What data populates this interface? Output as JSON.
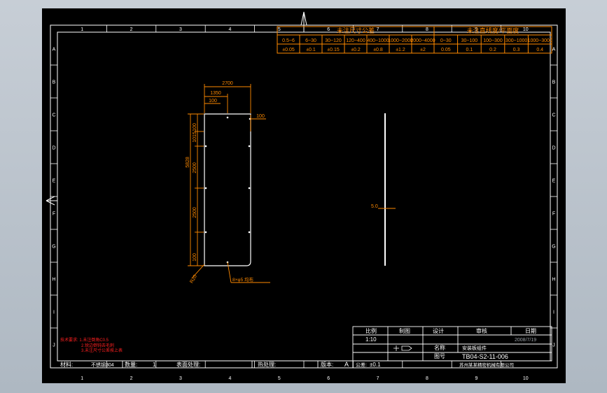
{
  "border": {
    "col_numbers": [
      "1",
      "2",
      "3",
      "4",
      "5",
      "6",
      "7",
      "8",
      "9",
      "10"
    ],
    "row_letters": [
      "A",
      "B",
      "C",
      "D",
      "E",
      "F",
      "G",
      "H",
      "I",
      "J"
    ]
  },
  "tolerance_table": {
    "left_header": "未注尺寸公差",
    "right_header": "未注直线度/平面度",
    "left_ranges": [
      "0.5~6",
      "6~30",
      "30~120",
      "120~400",
      "400~1000",
      "1000~2000",
      "2000~4000"
    ],
    "left_tols": [
      "±0.05",
      "±0.1",
      "±0.15",
      "±0.2",
      "±0.8",
      "±1.2",
      "±2"
    ],
    "right_ranges": [
      "0~30",
      "30~100",
      "100~300",
      "300~1000",
      "1000~3000"
    ],
    "right_tols": [
      "0.05",
      "0.1",
      "0.2",
      "0.3",
      "0.4"
    ]
  },
  "drawing": {
    "dim_2700": "2700",
    "dim_1350": "1350",
    "dim_100_top": "100",
    "dim_100_right": "100",
    "dim_100_vert_top": "100",
    "dim_1015": "1015",
    "dim_5828": "5828",
    "dim_2500_a": "2500",
    "dim_2500_b": "2500",
    "dim_100_vert_bot": "100",
    "dim_r20": "R20",
    "hole_note": "8×φ5 均布",
    "side_thickness": "5.0"
  },
  "title_block": {
    "scale_label": "比例",
    "scale_value": "1:10",
    "drawn_label": "制图",
    "design_label": "设计",
    "check_label": "审核",
    "date_label": "日期",
    "date_value": "2008/7/19",
    "name_label": "名称",
    "part_name": "安装板组件",
    "drawing_no_label": "图号",
    "drawing_no": "TB04-S2-11-006",
    "material_label": "材料:",
    "material_value": "不锈钢304",
    "qty_label": "数量:",
    "qty_value": "1",
    "surface_label": "表面处理:",
    "heat_label": "热处理:",
    "version_label": "版本:",
    "version_value": "A",
    "tol_label": "公差:",
    "tol_value": "±0.1",
    "company": "苏州某某精密机械有限公司"
  },
  "notes": [
    "技术要求: 1.未注倒角C0.5",
    "2.锐边倒钝去毛刺",
    "3.未注尺寸公差按上表"
  ]
}
